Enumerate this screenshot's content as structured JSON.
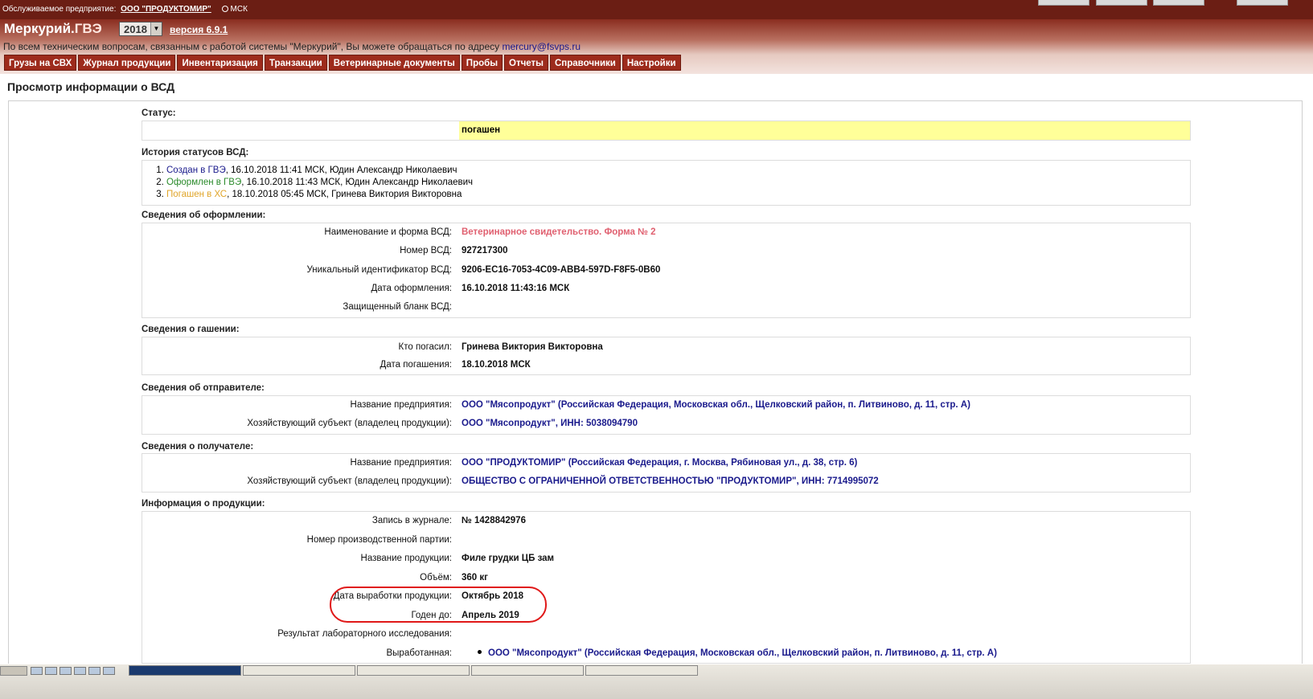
{
  "topbar": {
    "enterprise_label": "Обслуживаемое предприятие:",
    "enterprise_name": "ООО \"ПРОДУКТОМИР\"",
    "timezone": "МСК"
  },
  "header": {
    "logo_main": "Меркурий.",
    "logo_sub": "ГВЭ",
    "year": "2018",
    "version": "версия 6.9.1",
    "notice_text": "По всем техническим вопросам, связанным с работой системы \"Меркурий\", Вы можете обращаться по адресу",
    "notice_email": "mercury@fsvps.ru"
  },
  "menu": [
    "Грузы на СВХ",
    "Журнал продукции",
    "Инвентаризация",
    "Транзакции",
    "Ветеринарные документы",
    "Пробы",
    "Отчеты",
    "Справочники",
    "Настройки"
  ],
  "page": {
    "title": "Просмотр информации о ВСД"
  },
  "status": {
    "title": "Статус:",
    "value": "погашен"
  },
  "history": {
    "title": "История статусов ВСД:",
    "items": [
      {
        "status": "Создан в ГВЭ",
        "details": ", 16.10.2018 11:41 МСК, Юдин Александр Николаевич"
      },
      {
        "status": "Оформлен в ГВЭ",
        "details": ", 16.10.2018 11:43 МСК, Юдин Александр Николаевич"
      },
      {
        "status": "Погашен в ХС",
        "details": ", 18.10.2018 05:45 МСК, Гринева Виктория Викторовна"
      }
    ]
  },
  "registration": {
    "title": "Сведения об оформлении:",
    "rows": [
      {
        "label": "Наименование и форма ВСД:",
        "value": "Ветеринарное свидетельство. Форма № 2"
      },
      {
        "label": "Номер ВСД:",
        "value": "927217300"
      },
      {
        "label": "Уникальный идентификатор ВСД:",
        "value": "9206-EC16-7053-4C09-ABB4-597D-F8F5-0B60"
      },
      {
        "label": "Дата оформления:",
        "value": "16.10.2018 11:43:16 МСК"
      },
      {
        "label": "Защищенный бланк ВСД:",
        "value": ""
      }
    ]
  },
  "closing": {
    "title": "Сведения о гашении:",
    "rows": [
      {
        "label": "Кто погасил:",
        "value": "Гринева Виктория Викторовна"
      },
      {
        "label": "Дата погашения:",
        "value": "18.10.2018 МСК"
      }
    ]
  },
  "sender": {
    "title": "Сведения об отправителе:",
    "rows": [
      {
        "label": "Название предприятия:",
        "value": "ООО \"Мясопродукт\" (Российская Федерация, Московская обл., Щелковский район, п. Литвиново, д. 11, стр. А)"
      },
      {
        "label": "Хозяйствующий субъект (владелец продукции):",
        "value": "ООО \"Мясопродукт\", ИНН: 5038094790"
      }
    ]
  },
  "receiver": {
    "title": "Сведения о получателе:",
    "rows": [
      {
        "label": "Название предприятия:",
        "value": "ООО \"ПРОДУКТОМИР\" (Российская Федерация, г. Москва, Рябиновая ул., д. 38, стр. 6)"
      },
      {
        "label": "Хозяйствующий субъект (владелец продукции):",
        "value": "ОБЩЕСТВО С ОГРАНИЧЕННОЙ ОТВЕТСТВЕННОСТЬЮ \"ПРОДУКТОМИР\", ИНН: 7714995072"
      }
    ]
  },
  "product": {
    "title": "Информация о продукции:",
    "rows": [
      {
        "label": "Запись в журнале:",
        "value": "№ 1428842976"
      },
      {
        "label": "Номер производственной партии:",
        "value": ""
      },
      {
        "label": "Название продукции:",
        "value": "Филе грудки ЦБ зам"
      },
      {
        "label": "Объём:",
        "value": "360 кг"
      },
      {
        "label": "Дата выработки продукции:",
        "value": "Октябрь 2018"
      },
      {
        "label": "Годен до:",
        "value": "Апрель 2019"
      },
      {
        "label": "Результат лабораторного исследования:",
        "value": ""
      },
      {
        "label": "Выработанная:",
        "value": "ООО \"Мясопродукт\" (Российская Федерация, Московская обл., Щелковский район, п. Литвиново, д. 11, стр. А)"
      }
    ]
  },
  "colors": {
    "header_dark": "#6b1e14",
    "menu_bg": "#9d2b1c",
    "status_highlight": "#ffff99",
    "annotation_oval": "#e01818",
    "vsd_form_text": "#e06070"
  }
}
